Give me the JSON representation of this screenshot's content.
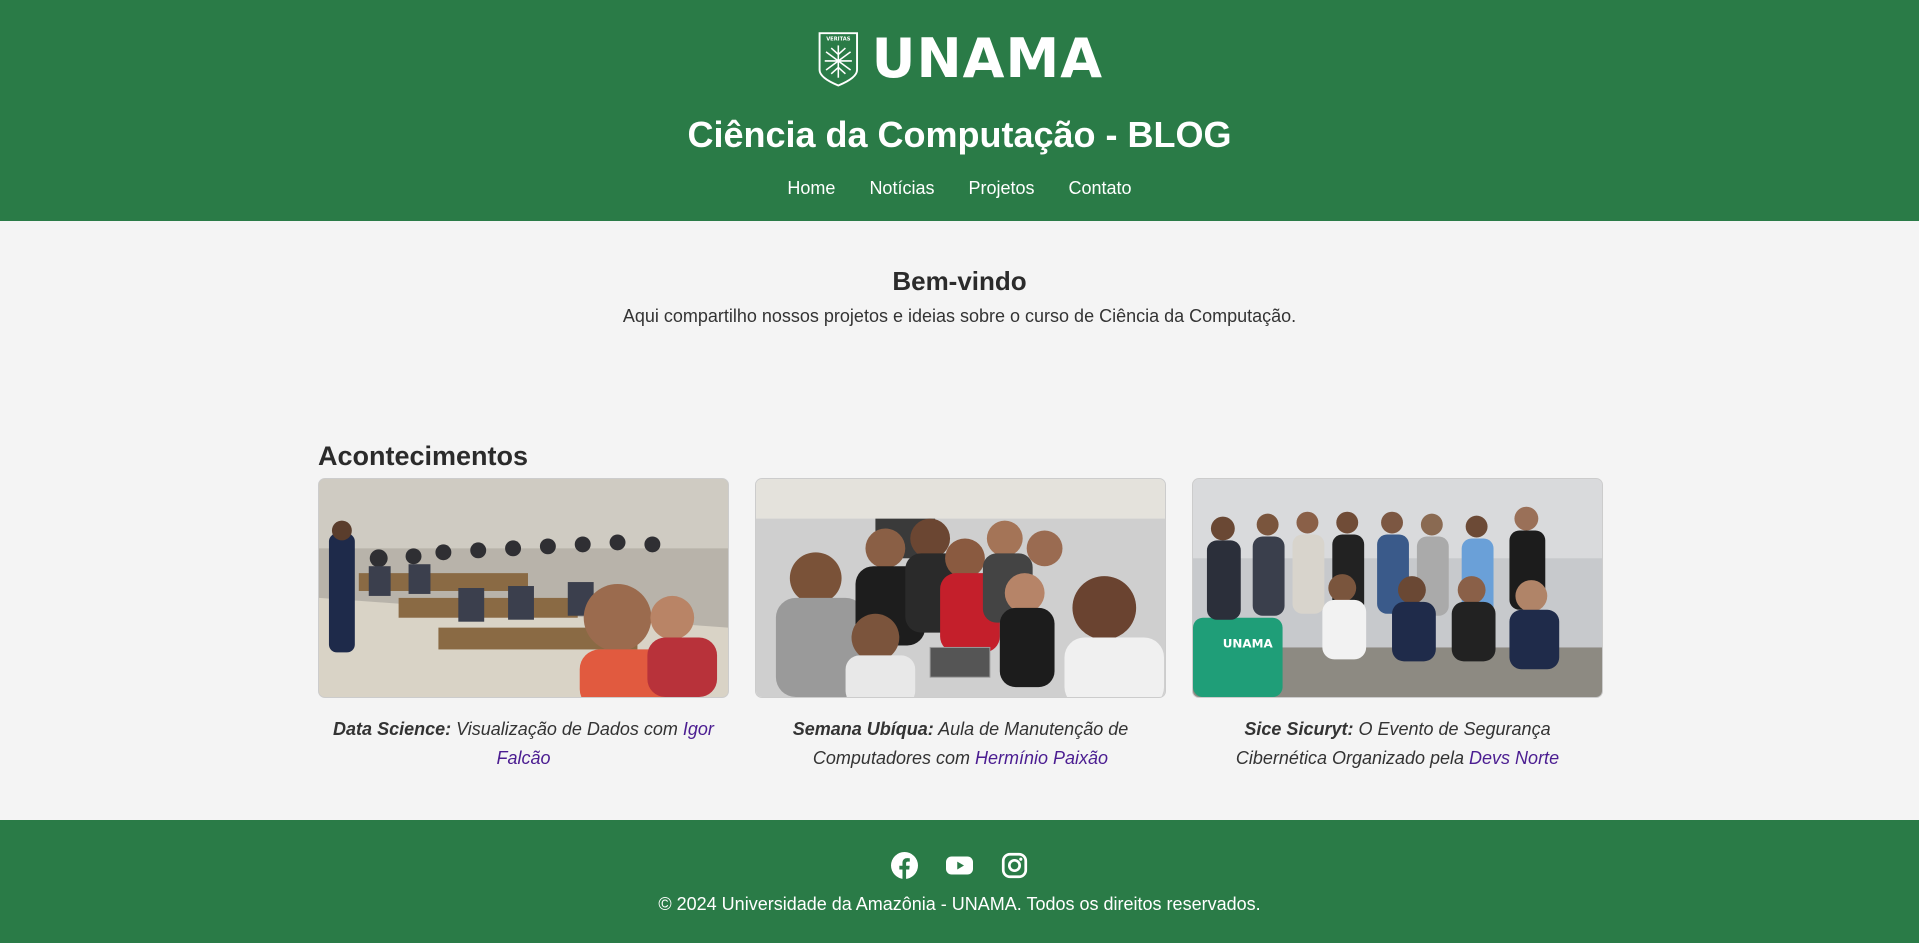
{
  "colors": {
    "brand": "#2a7b47",
    "link": "#4b1d91",
    "background": "#f4f4f4"
  },
  "header": {
    "logo_text": "UNAMA",
    "logo_seal_text": "VERITAS",
    "title": "Ciência da Computação - BLOG",
    "nav": [
      "Home",
      "Notícias",
      "Projetos",
      "Contato"
    ]
  },
  "welcome": {
    "title": "Bem-vindo",
    "text": "Aqui compartilho nossos projetos e ideias sobre o curso de Ciência da Computação."
  },
  "events": {
    "title": "Acontecimentos",
    "cards": [
      {
        "bold": "Data Science:",
        "text": " Visualização de Dados com ",
        "link": "Igor Falcão",
        "image": "group-photo-computer-lab"
      },
      {
        "bold": "Semana Ubíqua:",
        "text": " Aula de Manutenção de Computadores com ",
        "link": "Hermínio Paixão",
        "image": "group-selfie-maintenance-class"
      },
      {
        "bold": "Sice Sicuryt:",
        "text": " O Evento de Segurança Cibernética Organizado pela ",
        "link": "Devs Norte",
        "image": "group-photo-security-event"
      }
    ]
  },
  "footer": {
    "social": [
      "facebook-icon",
      "youtube-icon",
      "instagram-icon"
    ],
    "copyright": "© 2024 Universidade da Amazônia - UNAMA. Todos os direitos reservados."
  }
}
